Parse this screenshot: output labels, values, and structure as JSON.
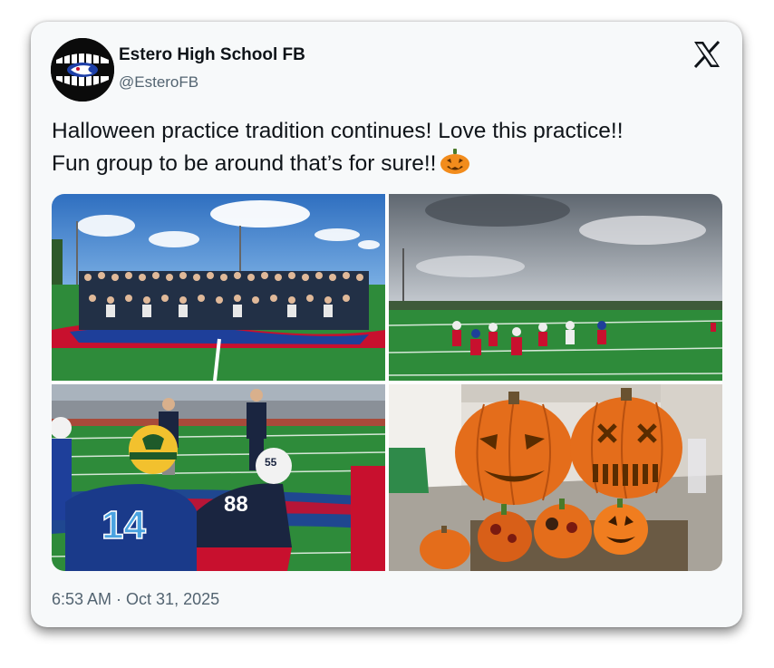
{
  "author": {
    "name": "Estero High School FB",
    "handle": "@EsteroFB",
    "avatar_icon": "estero-wildcats-football-logo"
  },
  "platform": {
    "logo_icon": "x-logo-icon"
  },
  "tweet": {
    "line1": "Halloween practice tradition continues! Love this practice!!",
    "line2": "Fun group to be around that’s for sure!!",
    "emoji_icon": "jack-o-lantern-emoji"
  },
  "media": [
    {
      "subject": "team-group-photo"
    },
    {
      "subject": "practice-line-drill"
    },
    {
      "subject": "players-in-stance",
      "jersey_numbers": [
        "14",
        "55",
        "88"
      ]
    },
    {
      "subject": "carved-pumpkins"
    }
  ],
  "timestamp": {
    "time": "6:53 AM",
    "separator": " · ",
    "date": "Oct 31, 2025"
  },
  "colors": {
    "text": "#0f1419",
    "secondary": "#536471",
    "card_bg": "#f7f9fa",
    "turf": "#2e8b3a",
    "sky": "#3f7fc4",
    "pumpkin": "#e46d1b"
  }
}
